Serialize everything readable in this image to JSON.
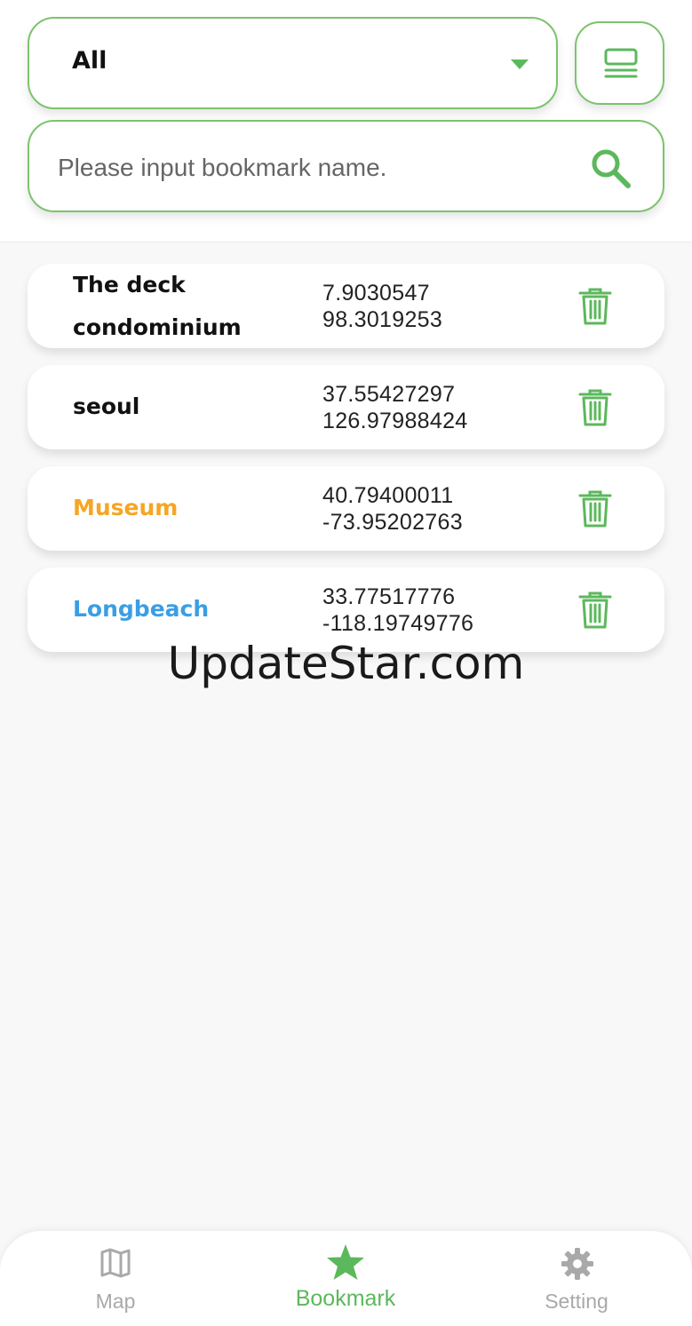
{
  "header": {
    "category_filter": {
      "selected": "All"
    },
    "search": {
      "placeholder": "Please input bookmark name."
    }
  },
  "bookmarks": [
    {
      "name": "The deck condominium",
      "latitude": "7.9030547",
      "longitude": "98.3019253",
      "name_color": "#111111"
    },
    {
      "name": "seoul",
      "latitude": "37.55427297",
      "longitude": "126.97988424",
      "name_color": "#111111"
    },
    {
      "name": "Museum",
      "latitude": "40.79400011",
      "longitude": "-73.95202763",
      "name_color": "#f5a623"
    },
    {
      "name": "Longbeach",
      "latitude": "33.77517776",
      "longitude": "-118.19749776",
      "name_color": "#3a9ee4"
    }
  ],
  "watermark": "UpdateStar.com",
  "bottom_nav": {
    "items": [
      {
        "label": "Map",
        "icon": "map-icon",
        "active": false
      },
      {
        "label": "Bookmark",
        "icon": "star-icon",
        "active": true
      },
      {
        "label": "Setting",
        "icon": "gear-icon",
        "active": false
      }
    ]
  },
  "colors": {
    "accent": "#5cb85c",
    "accent_border": "#7cc36d",
    "inactive": "#a9a9a9"
  }
}
